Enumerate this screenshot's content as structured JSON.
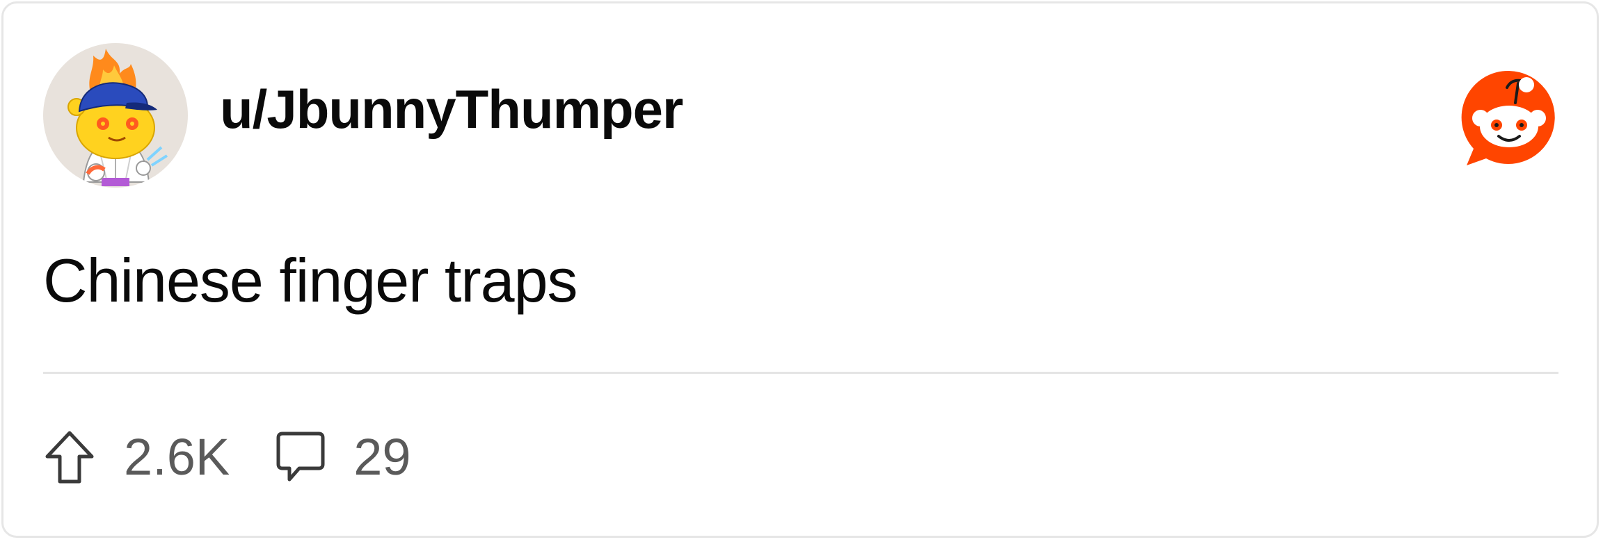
{
  "post": {
    "username": "u/JbunnyThumper",
    "title": "Chinese finger traps",
    "upvotes": "2.6K",
    "comments": "29"
  },
  "icons": {
    "avatar": "snoo-avatar-fire-cap",
    "logo": "reddit-logo-icon",
    "upvote": "upvote-arrow-icon",
    "comment": "comment-bubble-icon"
  },
  "colors": {
    "reddit_orange": "#ff4500",
    "text_primary": "#0a0a0a",
    "text_secondary": "#5a5a5a",
    "divider": "#e4e4e4",
    "border": "#e6e6e6"
  }
}
